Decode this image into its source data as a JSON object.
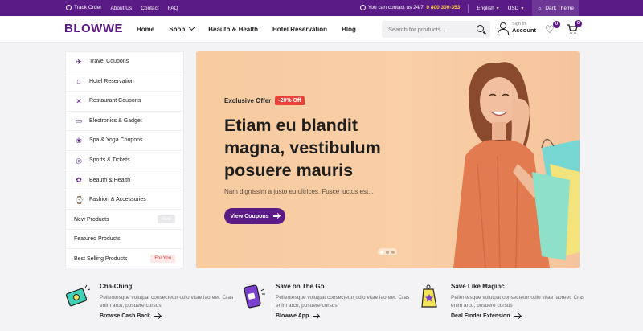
{
  "topbar": {
    "links": [
      "Track Order",
      "About Us",
      "Contact",
      "FAQ"
    ],
    "contact_text": "You can contact us 24/7",
    "phone": "0 800 300-353",
    "language": "English",
    "currency": "USD",
    "theme_toggle": "Dark Theme"
  },
  "header": {
    "logo": "BLOWWE",
    "nav": [
      "Home",
      "Shop",
      "Beauth & Health",
      "Hotel Reservation",
      "Blog"
    ],
    "search_placeholder": "Search for products...",
    "account_line1": "Sign In",
    "account_line2": "Account",
    "wishlist_count": "0",
    "cart_count": "0"
  },
  "sidebar": {
    "categories": [
      {
        "label": "Travel Coupons",
        "icon": "plane-icon"
      },
      {
        "label": "Hotel Reservation",
        "icon": "hotel-icon"
      },
      {
        "label": "Restaurant Coupons",
        "icon": "cutlery-icon"
      },
      {
        "label": "Electronics & Gadget",
        "icon": "monitor-icon"
      },
      {
        "label": "Spa & Yoga Coupons",
        "icon": "lotus-icon"
      },
      {
        "label": "Sports & Tickets",
        "icon": "ball-icon"
      },
      {
        "label": "Beauth & Health",
        "icon": "flower-icon"
      },
      {
        "label": "Fashion & Accessories",
        "icon": "watch-icon"
      }
    ],
    "extras": [
      {
        "label": "New Products",
        "tag": "New"
      },
      {
        "label": "Featured Products",
        "tag": ""
      },
      {
        "label": "Best Selling Products",
        "tag": "For You"
      }
    ]
  },
  "hero": {
    "offer_label": "Exclusive Offer",
    "discount": "-20% Off",
    "headline": "Etiam eu blandit magna, vestibulum posuere mauris",
    "subtext": "Nam dignissim a justo eu ultrices. Fusce luctus est...",
    "cta": "View Coupons",
    "slide_count": 3,
    "active_slide": 1
  },
  "features": [
    {
      "title": "Cha-Ching",
      "desc": "Pellentesque volutpat consectetur odio vitae laoreet. Cras enim arcu, posuere cursus",
      "link": "Browse Cash Back",
      "icon": "cash-icon"
    },
    {
      "title": "Save on The Go",
      "desc": "Pellentesque volutpat consectetur odio vitae laoreet. Cras enim arcu, posuere cursus",
      "link": "Blowwe App",
      "icon": "phone-icon"
    },
    {
      "title": "Save Like Maginc",
      "desc": "Pellentesque volutpat consectetur odio vitae laoreet. Cras enim arcu, posuere cursus",
      "link": "Deal Finder Extension",
      "icon": "tag-icon"
    }
  ],
  "colors": {
    "brand": "#5a1b87",
    "accent": "#ffd13b",
    "discount": "#e8433b",
    "hero_bg": "#f8cba0"
  }
}
